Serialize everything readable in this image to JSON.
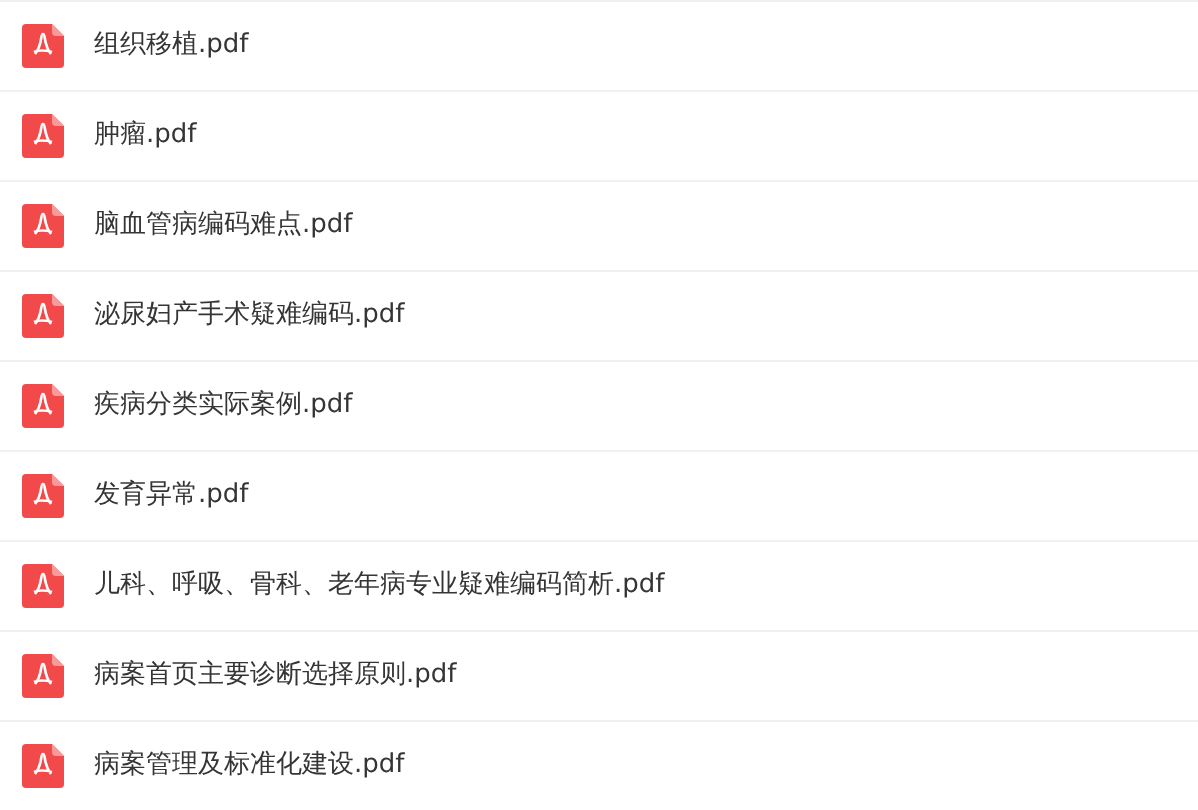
{
  "files": [
    {
      "name": "组织移植.pdf"
    },
    {
      "name": "肿瘤.pdf"
    },
    {
      "name": "脑血管病编码难点.pdf"
    },
    {
      "name": "泌尿妇产手术疑难编码.pdf"
    },
    {
      "name": "疾病分类实际案例.pdf"
    },
    {
      "name": "发育异常.pdf"
    },
    {
      "name": "儿科、呼吸、骨科、老年病专业疑难编码简析.pdf"
    },
    {
      "name": "病案首页主要诊断选择原则.pdf"
    },
    {
      "name": "病案管理及标准化建设.pdf"
    }
  ]
}
